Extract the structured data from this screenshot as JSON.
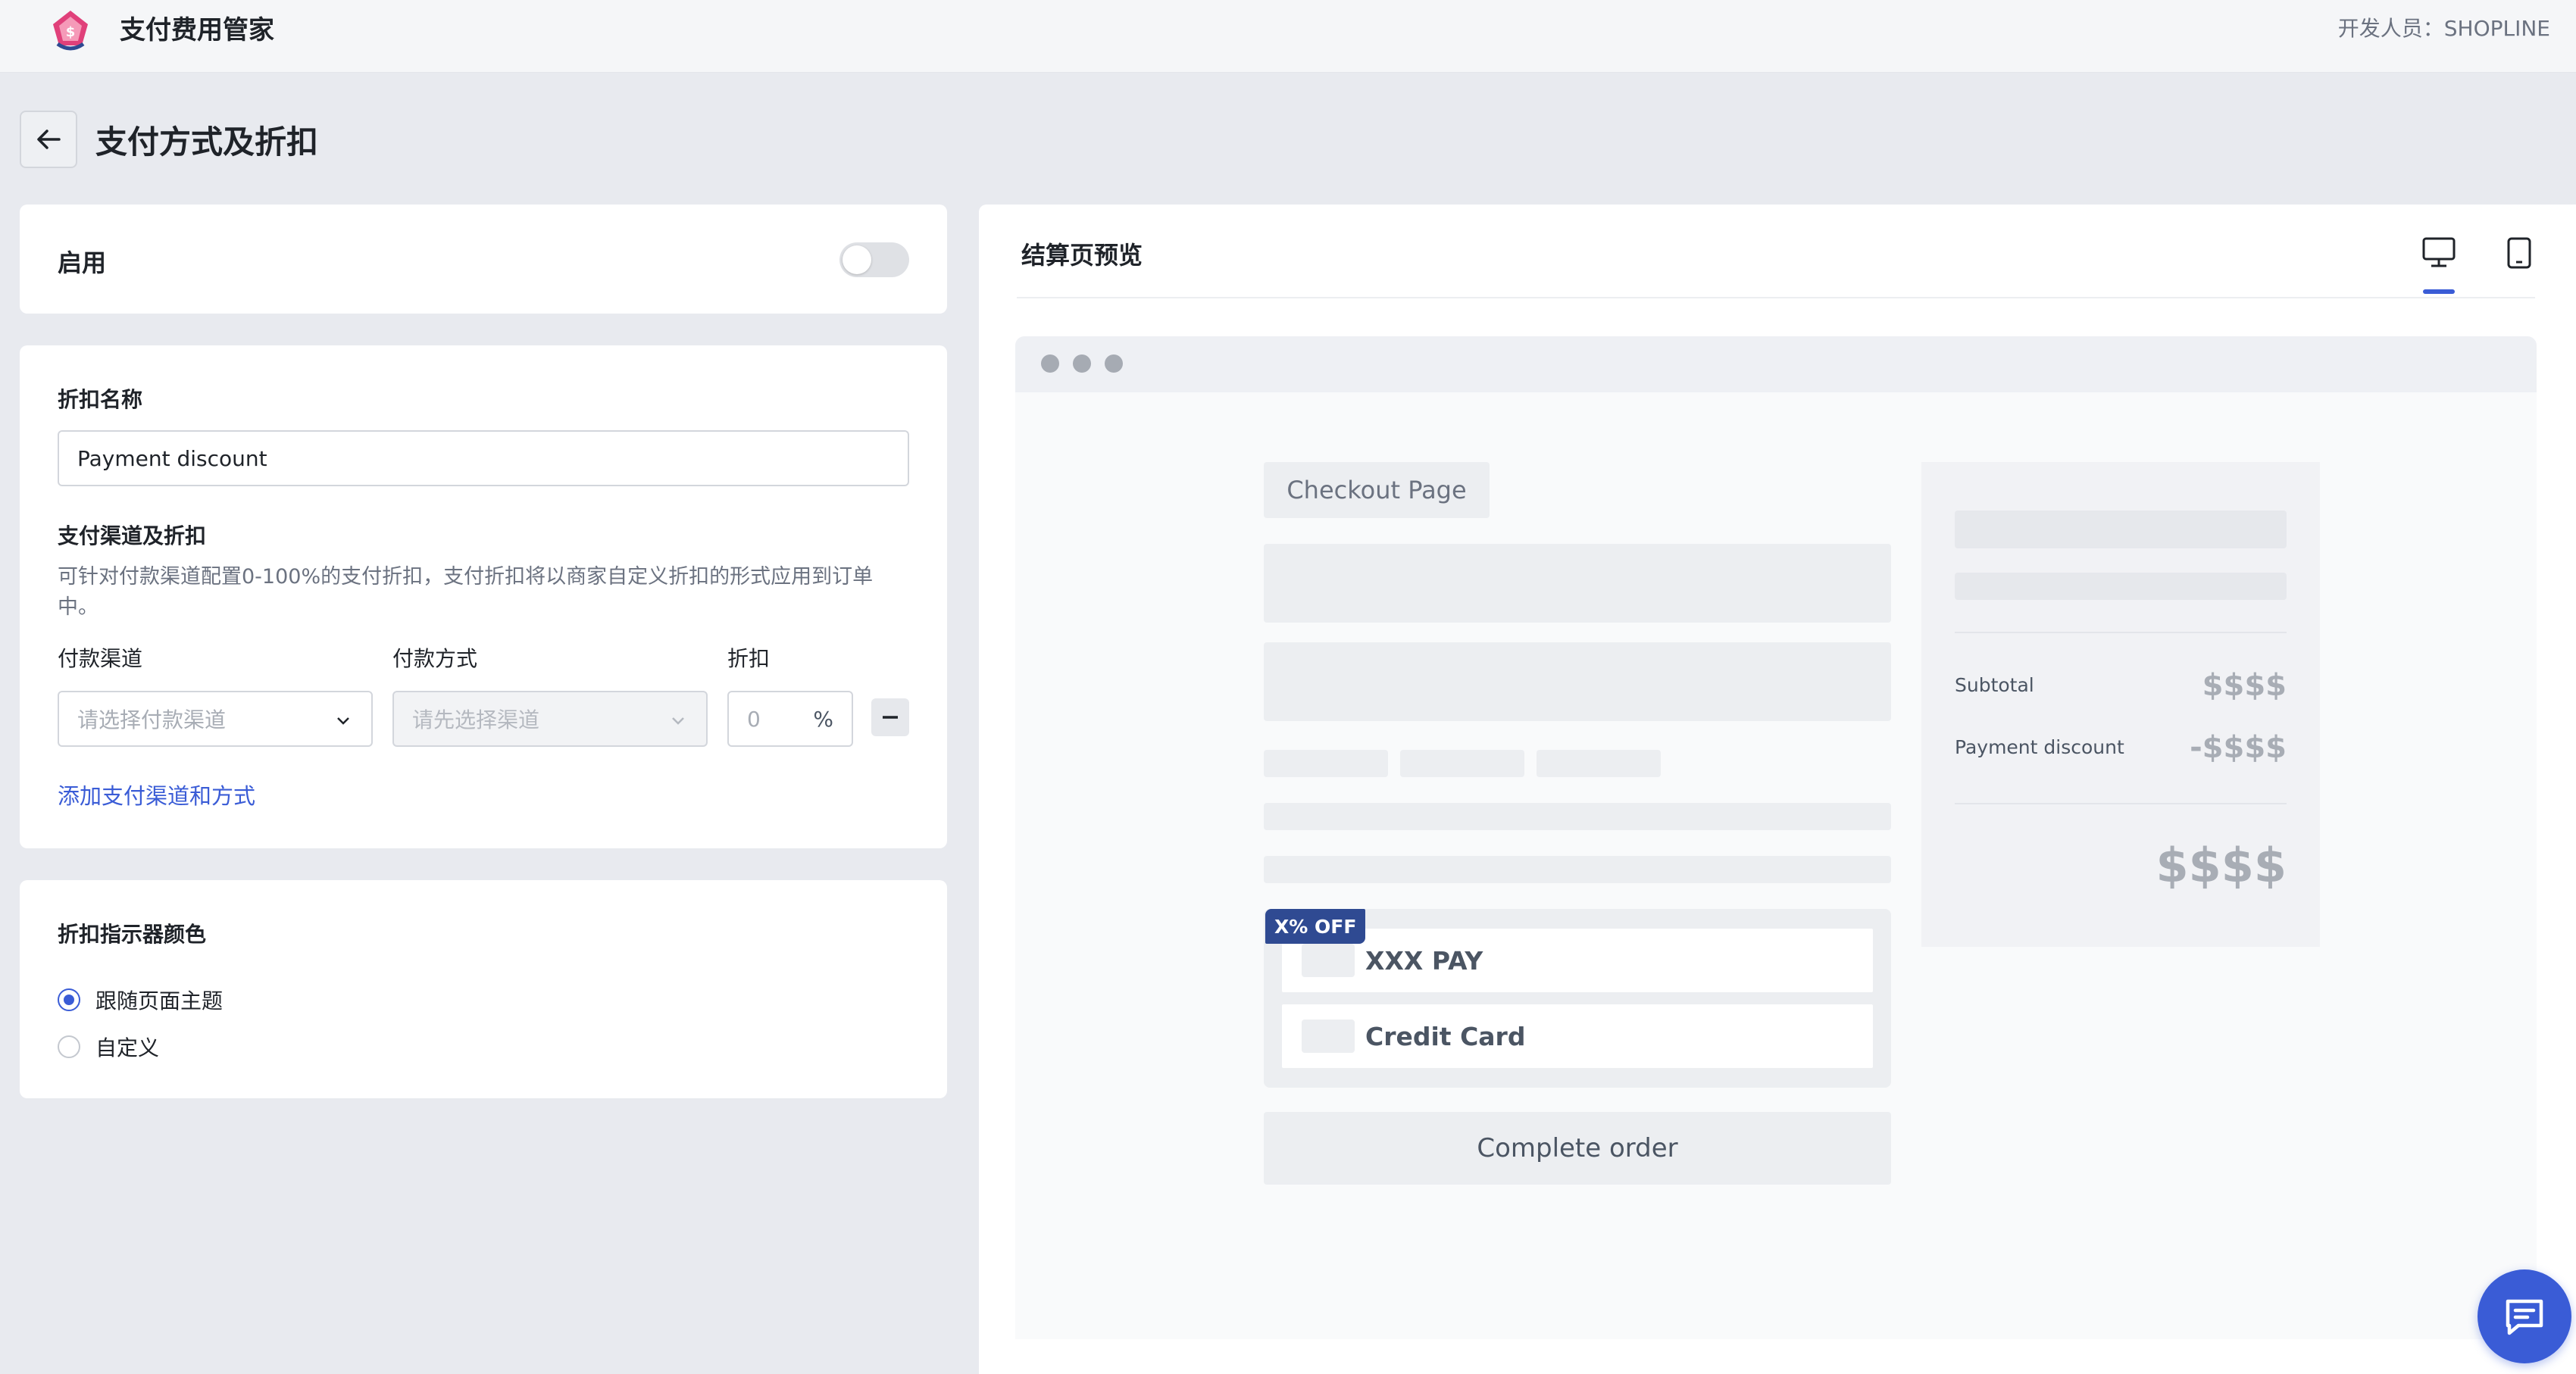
{
  "header": {
    "app_name": "支付费用管家",
    "developer": "开发人员：SHOPLINE"
  },
  "page": {
    "title": "支付方式及折扣"
  },
  "enable": {
    "label": "启用",
    "value": false
  },
  "discount_form": {
    "name_label": "折扣名称",
    "name_value": "Payment discount",
    "channels_label": "支付渠道及折扣",
    "channels_help": "可针对付款渠道配置0-100%的支付折扣，支付折扣将以商家自定义折扣的形式应用到订单中。",
    "col_channel": "付款渠道",
    "col_method": "付款方式",
    "col_discount": "折扣",
    "channel_placeholder": "请选择付款渠道",
    "method_placeholder": "请先选择渠道",
    "discount_placeholder": "0",
    "percent_sign": "%",
    "add_link": "添加支付渠道和方式"
  },
  "indicator_color": {
    "label": "折扣指示器颜色",
    "options": [
      {
        "label": "跟随页面主题",
        "selected": true
      },
      {
        "label": "自定义",
        "selected": false
      }
    ]
  },
  "preview": {
    "title": "结算页预览",
    "checkout_title": "Checkout Page",
    "off_badge": "X% OFF",
    "payment_options": [
      "XXX PAY",
      "Credit Card"
    ],
    "complete_button": "Complete order",
    "summary": {
      "subtotal_label": "Subtotal",
      "subtotal_value": "$$$$",
      "discount_label": "Payment discount",
      "discount_value": "-$$$$",
      "total_value": "$$$$"
    }
  },
  "icons": {
    "back": "arrow-left-icon",
    "desktop": "desktop-icon",
    "tablet": "tablet-icon",
    "chat": "chat-icon",
    "logo": "app-logo"
  },
  "colors": {
    "accent": "#3a5cd6",
    "badge": "#2f4a92",
    "logo_pink": "#e0407a"
  }
}
